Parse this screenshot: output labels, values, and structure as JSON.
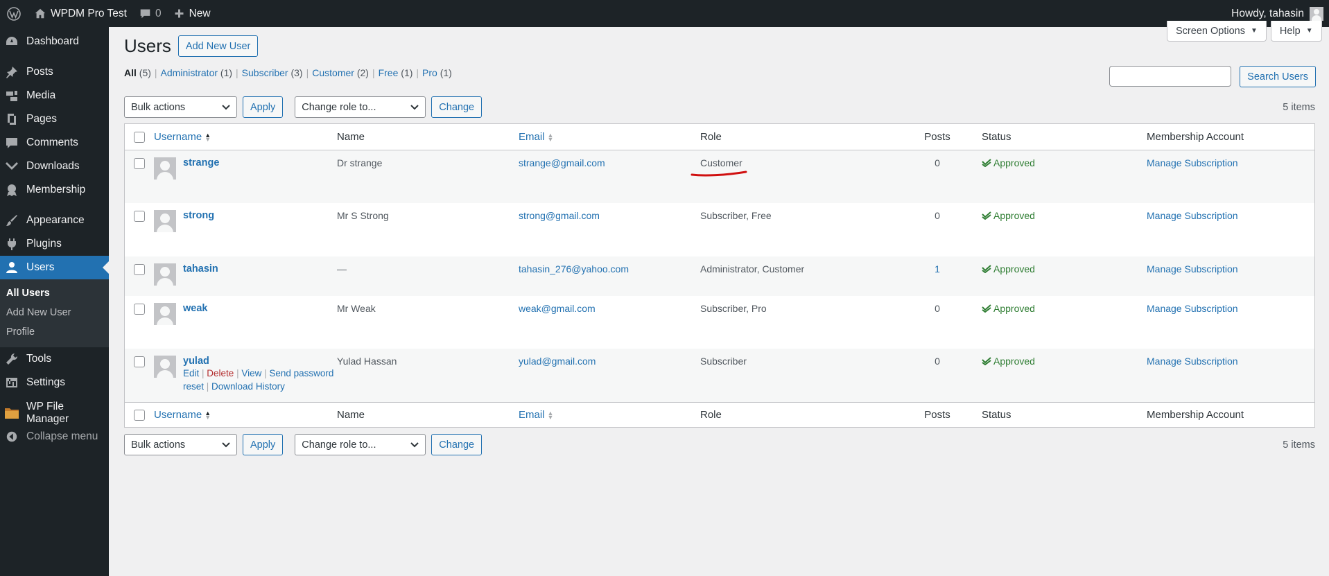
{
  "adminbar": {
    "site_name": "WPDM Pro Test",
    "comments_count": "0",
    "new_label": "New",
    "howdy": "Howdy, tahasin"
  },
  "sidebar": {
    "items": [
      {
        "label": "Dashboard",
        "icon": "dashboard-icon"
      },
      {
        "label": "Posts",
        "icon": "pin-icon"
      },
      {
        "label": "Media",
        "icon": "media-icon"
      },
      {
        "label": "Pages",
        "icon": "pages-icon"
      },
      {
        "label": "Comments",
        "icon": "comment-icon"
      },
      {
        "label": "Downloads",
        "icon": "download-icon"
      },
      {
        "label": "Membership",
        "icon": "membership-icon"
      },
      {
        "label": "Appearance",
        "icon": "brush-icon"
      },
      {
        "label": "Plugins",
        "icon": "plug-icon"
      },
      {
        "label": "Users",
        "icon": "users-icon"
      },
      {
        "label": "Tools",
        "icon": "wrench-icon"
      },
      {
        "label": "Settings",
        "icon": "settings-icon"
      },
      {
        "label": "WP File Manager",
        "icon": "folder-icon"
      },
      {
        "label": "Collapse menu",
        "icon": "collapse-icon"
      }
    ],
    "users_submenu": [
      "All Users",
      "Add New User",
      "Profile"
    ]
  },
  "screen_meta": {
    "screen_options": "Screen Options",
    "help": "Help"
  },
  "page": {
    "title": "Users",
    "add_new": "Add New User",
    "search_button": "Search Users",
    "search_value": "",
    "items_count": "5 items"
  },
  "filters": [
    {
      "label": "All",
      "count": "(5)"
    },
    {
      "label": "Administrator",
      "count": "(1)"
    },
    {
      "label": "Subscriber",
      "count": "(3)"
    },
    {
      "label": "Customer",
      "count": "(2)"
    },
    {
      "label": "Free",
      "count": "(1)"
    },
    {
      "label": "Pro",
      "count": "(1)"
    }
  ],
  "tablenav": {
    "bulk_actions": "Bulk actions",
    "apply": "Apply",
    "change_role": "Change role to...",
    "change": "Change"
  },
  "columns": {
    "username": "Username",
    "name": "Name",
    "email": "Email",
    "role": "Role",
    "posts": "Posts",
    "status": "Status",
    "membership": "Membership Account"
  },
  "rows": [
    {
      "username": "strange",
      "name": "Dr strange",
      "email": "strange@gmail.com",
      "role": "Customer",
      "posts": "0",
      "status": "Approved",
      "membership": "Manage Subscription"
    },
    {
      "username": "strong",
      "name": "Mr S Strong",
      "email": "strong@gmail.com",
      "role": "Subscriber, Free",
      "posts": "0",
      "status": "Approved",
      "membership": "Manage Subscription"
    },
    {
      "username": "tahasin",
      "name": "—",
      "email": "tahasin_276@yahoo.com",
      "role": "Administrator, Customer",
      "posts": "1",
      "status": "Approved",
      "membership": "Manage Subscription"
    },
    {
      "username": "weak",
      "name": "Mr Weak",
      "email": "weak@gmail.com",
      "role": "Subscriber, Pro",
      "posts": "0",
      "status": "Approved",
      "membership": "Manage Subscription"
    },
    {
      "username": "yulad",
      "name": "Yulad Hassan",
      "email": "yulad@gmail.com",
      "role": "Subscriber",
      "posts": "0",
      "status": "Approved",
      "membership": "Manage Subscription"
    }
  ],
  "row_actions": {
    "edit": "Edit",
    "delete": "Delete",
    "view": "View",
    "send_reset": "Send password reset",
    "download_history": "Download History"
  }
}
